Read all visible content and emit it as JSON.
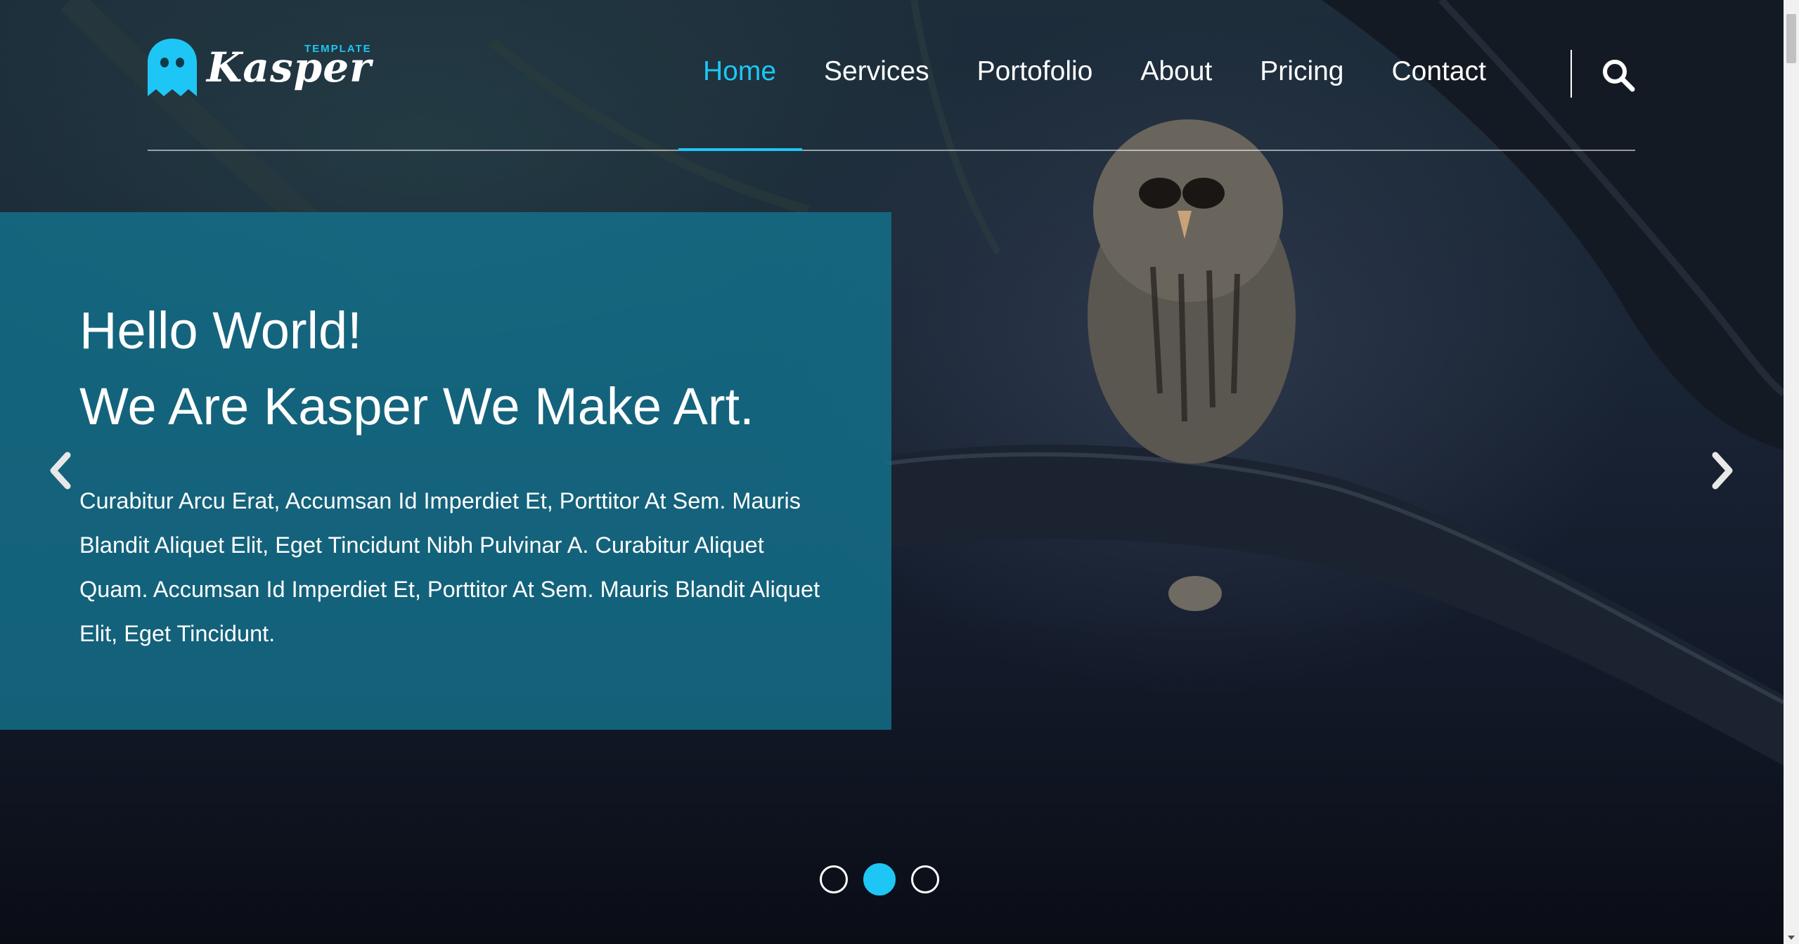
{
  "brand": {
    "name": "Kasper",
    "sub": "TEMPLATE"
  },
  "nav": {
    "items": [
      {
        "label": "Home",
        "active": true
      },
      {
        "label": "Services",
        "active": false
      },
      {
        "label": "Portofolio",
        "active": false
      },
      {
        "label": "About",
        "active": false
      },
      {
        "label": "Pricing",
        "active": false
      },
      {
        "label": "Contact",
        "active": false
      }
    ],
    "search_icon": "search-icon"
  },
  "hero": {
    "title_line1": "Hello World!",
    "title_line2": "We Are Kasper We Make Art.",
    "text": "Curabitur Arcu Erat, Accumsan Id Imperdiet Et, Porttitor At Sem. Mauris Blandit Aliquet Elit, Eget Tincidunt Nibh Pulvinar A. Curabitur Aliquet Quam. Accumsan Id Imperdiet Et, Porttitor At Sem. Mauris Blandit Aliquet Elit, Eget Tincidunt."
  },
  "slider": {
    "prev_icon": "chevron-left-icon",
    "next_icon": "chevron-right-icon",
    "slide_count": 3,
    "active_index": 1
  },
  "colors": {
    "accent": "#1ec6f5",
    "caption_bg": "#13718c",
    "text": "#ffffff"
  }
}
